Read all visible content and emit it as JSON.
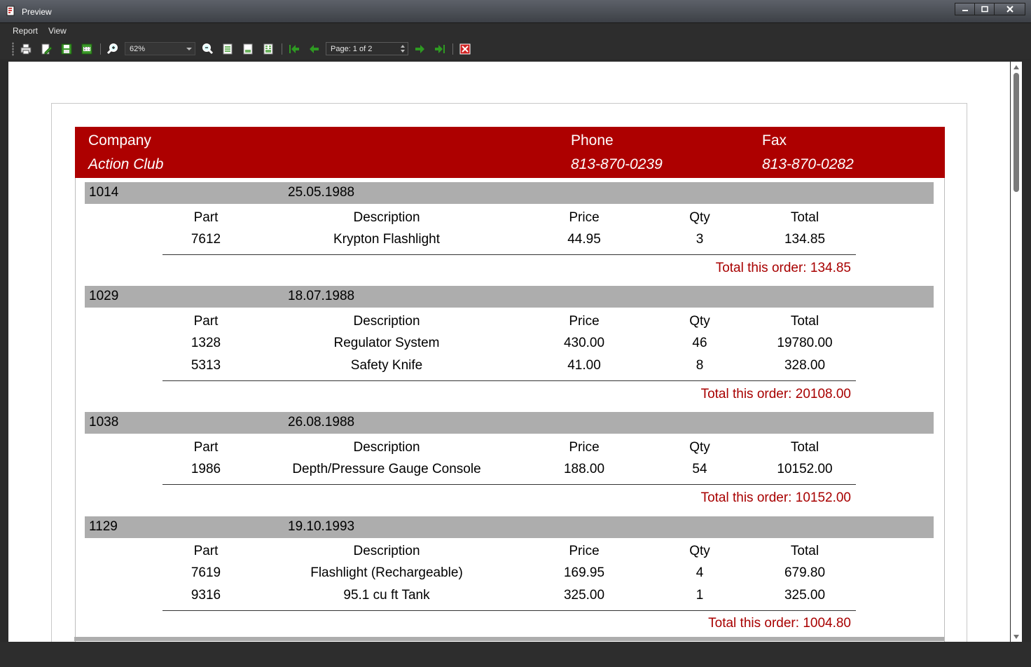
{
  "window": {
    "title": "Preview"
  },
  "menu": {
    "report": "Report",
    "view": "View"
  },
  "toolbar": {
    "zoom_value": "62%",
    "page_value": "Page: 1 of 2"
  },
  "report": {
    "header": {
      "company_label": "Company",
      "company_value": "Action Club",
      "phone_label": "Phone",
      "phone_value": "813-870-0239",
      "fax_label": "Fax",
      "fax_value": "813-870-0282"
    },
    "columns": {
      "part": "Part",
      "description": "Description",
      "price": "Price",
      "qty": "Qty",
      "total": "Total"
    },
    "total_label": "Total this order:",
    "orders": [
      {
        "no": "1014",
        "date": "25.05.1988",
        "items": [
          {
            "part": "7612",
            "description": "Krypton Flashlight",
            "price": "44.95",
            "qty": "3",
            "total": "134.85"
          }
        ],
        "order_total": "134.85"
      },
      {
        "no": "1029",
        "date": "18.07.1988",
        "items": [
          {
            "part": "1328",
            "description": "Regulator System",
            "price": "430.00",
            "qty": "46",
            "total": "19780.00"
          },
          {
            "part": "5313",
            "description": "Safety Knife",
            "price": "41.00",
            "qty": "8",
            "total": "328.00"
          }
        ],
        "order_total": "20108.00"
      },
      {
        "no": "1038",
        "date": "26.08.1988",
        "items": [
          {
            "part": "1986",
            "description": "Depth/Pressure Gauge Console",
            "price": "188.00",
            "qty": "54",
            "total": "10152.00"
          }
        ],
        "order_total": "10152.00"
      },
      {
        "no": "1129",
        "date": "19.10.1993",
        "items": [
          {
            "part": "7619",
            "description": "Flashlight (Rechargeable)",
            "price": "169.95",
            "qty": "4",
            "total": "679.80"
          },
          {
            "part": "9316",
            "description": "95.1 cu ft Tank",
            "price": "325.00",
            "qty": "1",
            "total": "325.00"
          }
        ],
        "order_total": "1004.80"
      }
    ]
  }
}
